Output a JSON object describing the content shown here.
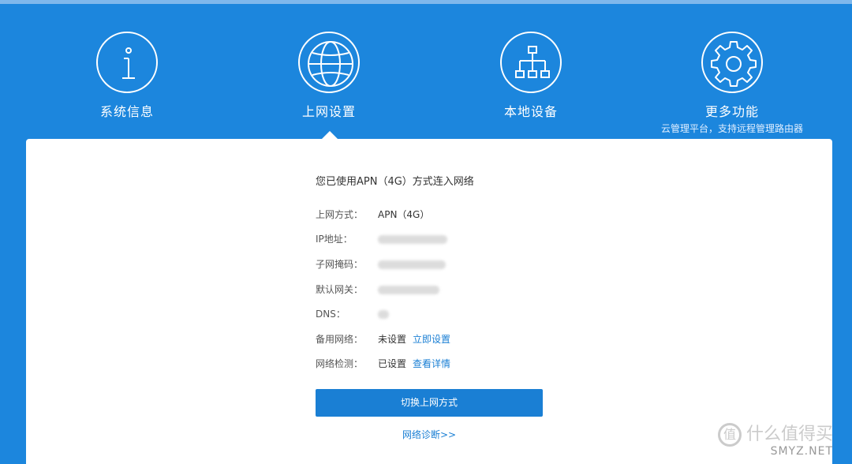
{
  "nav": {
    "items": [
      {
        "label": "系统信息",
        "icon": "info-icon"
      },
      {
        "label": "上网设置",
        "icon": "globe-icon",
        "active": true
      },
      {
        "label": "本地设备",
        "icon": "device-tree-icon"
      },
      {
        "label": "更多功能",
        "icon": "gear-icon",
        "sub": "云管理平台，支持远程管理路由器"
      }
    ]
  },
  "main": {
    "headline": "您已使用APN（4G）方式连入网络",
    "rows": [
      {
        "key": "上网方式：",
        "value": "APN（4G）"
      },
      {
        "key": "IP地址：",
        "value": ""
      },
      {
        "key": "子网掩码：",
        "value": ""
      },
      {
        "key": "默认网关：",
        "value": ""
      },
      {
        "key": "DNS：",
        "value": ""
      },
      {
        "key": "备用网络：",
        "value": "未设置",
        "link": "立即设置"
      },
      {
        "key": "网络检测：",
        "value": "已设置",
        "link": "查看详情"
      }
    ],
    "switch_button": "切换上网方式",
    "diagnose_link": "网络诊断>>"
  },
  "watermark": {
    "logo": "值",
    "text": "什么值得买",
    "site": "SMYZ.NET"
  },
  "colors": {
    "background": "#1c86dd",
    "accent": "#1a7fd4",
    "panel": "#ffffff"
  }
}
